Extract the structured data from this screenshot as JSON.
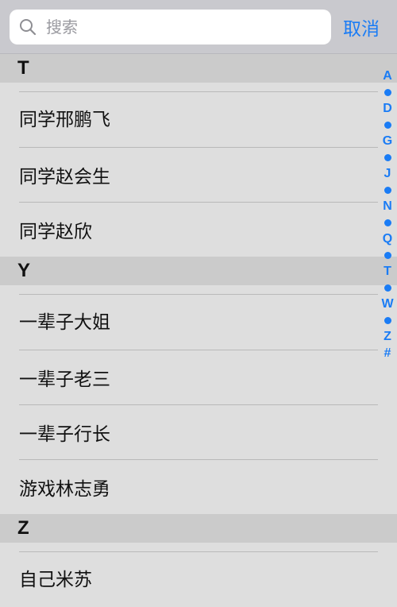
{
  "search": {
    "placeholder": "搜索",
    "cancel_label": "取消"
  },
  "sections": [
    {
      "letter": "T",
      "items": [
        "同学邢鹏飞",
        "同学赵会生",
        "同学赵欣"
      ]
    },
    {
      "letter": "Y",
      "items": [
        "一辈子大姐",
        "一辈子老三",
        "一辈子行长",
        "游戏林志勇"
      ]
    },
    {
      "letter": "Z",
      "items": [
        "自己米苏"
      ]
    }
  ],
  "index_bar": [
    "A",
    "•",
    "D",
    "•",
    "G",
    "•",
    "J",
    "•",
    "N",
    "•",
    "Q",
    "•",
    "T",
    "•",
    "W",
    "•",
    "Z",
    "#"
  ],
  "colors": {
    "accent": "#1a7cf5",
    "section_bg": "#cbcbcb",
    "list_bg": "#dedede",
    "topbar_bg": "#c9c9ce"
  },
  "icons": {
    "search": "search-icon"
  }
}
